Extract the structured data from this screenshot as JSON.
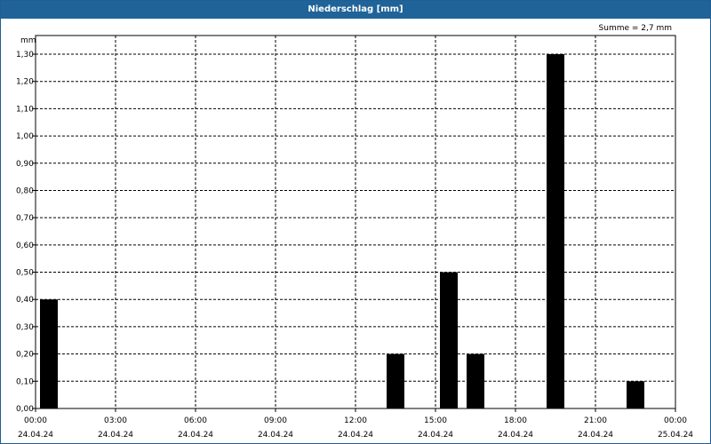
{
  "window": {
    "title": "Niederschlag [mm]"
  },
  "chart_data": {
    "type": "bar",
    "title": "Niederschlag [mm]",
    "ylabel": "mm",
    "sum_label": "Summe = 2,7 mm",
    "xlim": [
      "2024-04-24T00:00",
      "2024-04-25T00:00"
    ],
    "ylim": [
      0,
      1.3
    ],
    "grid": true,
    "y_ticks": [
      "0,00",
      "0,10",
      "0,20",
      "0,30",
      "0,40",
      "0,50",
      "0,60",
      "0,70",
      "0,80",
      "0,90",
      "1,00",
      "1,10",
      "1,20",
      "1,30"
    ],
    "x_ticks": [
      {
        "time": "00:00",
        "date": "24.04.24"
      },
      {
        "time": "03:00",
        "date": "24.04.24"
      },
      {
        "time": "06:00",
        "date": "24.04.24"
      },
      {
        "time": "09:00",
        "date": "24.04.24"
      },
      {
        "time": "12:00",
        "date": "24.04.24"
      },
      {
        "time": "15:00",
        "date": "24.04.24"
      },
      {
        "time": "18:00",
        "date": "24.04.24"
      },
      {
        "time": "21:00",
        "date": "24.04.24"
      },
      {
        "time": "00:00",
        "date": "25.04.24"
      }
    ],
    "bars": [
      {
        "time": "2024-04-24T00:00",
        "value": 0.4
      },
      {
        "time": "2024-04-24T13:00",
        "value": 0.2
      },
      {
        "time": "2024-04-24T15:00",
        "value": 0.5
      },
      {
        "time": "2024-04-24T16:00",
        "value": 0.2
      },
      {
        "time": "2024-04-24T19:00",
        "value": 1.3
      },
      {
        "time": "2024-04-24T22:00",
        "value": 0.1
      }
    ]
  }
}
